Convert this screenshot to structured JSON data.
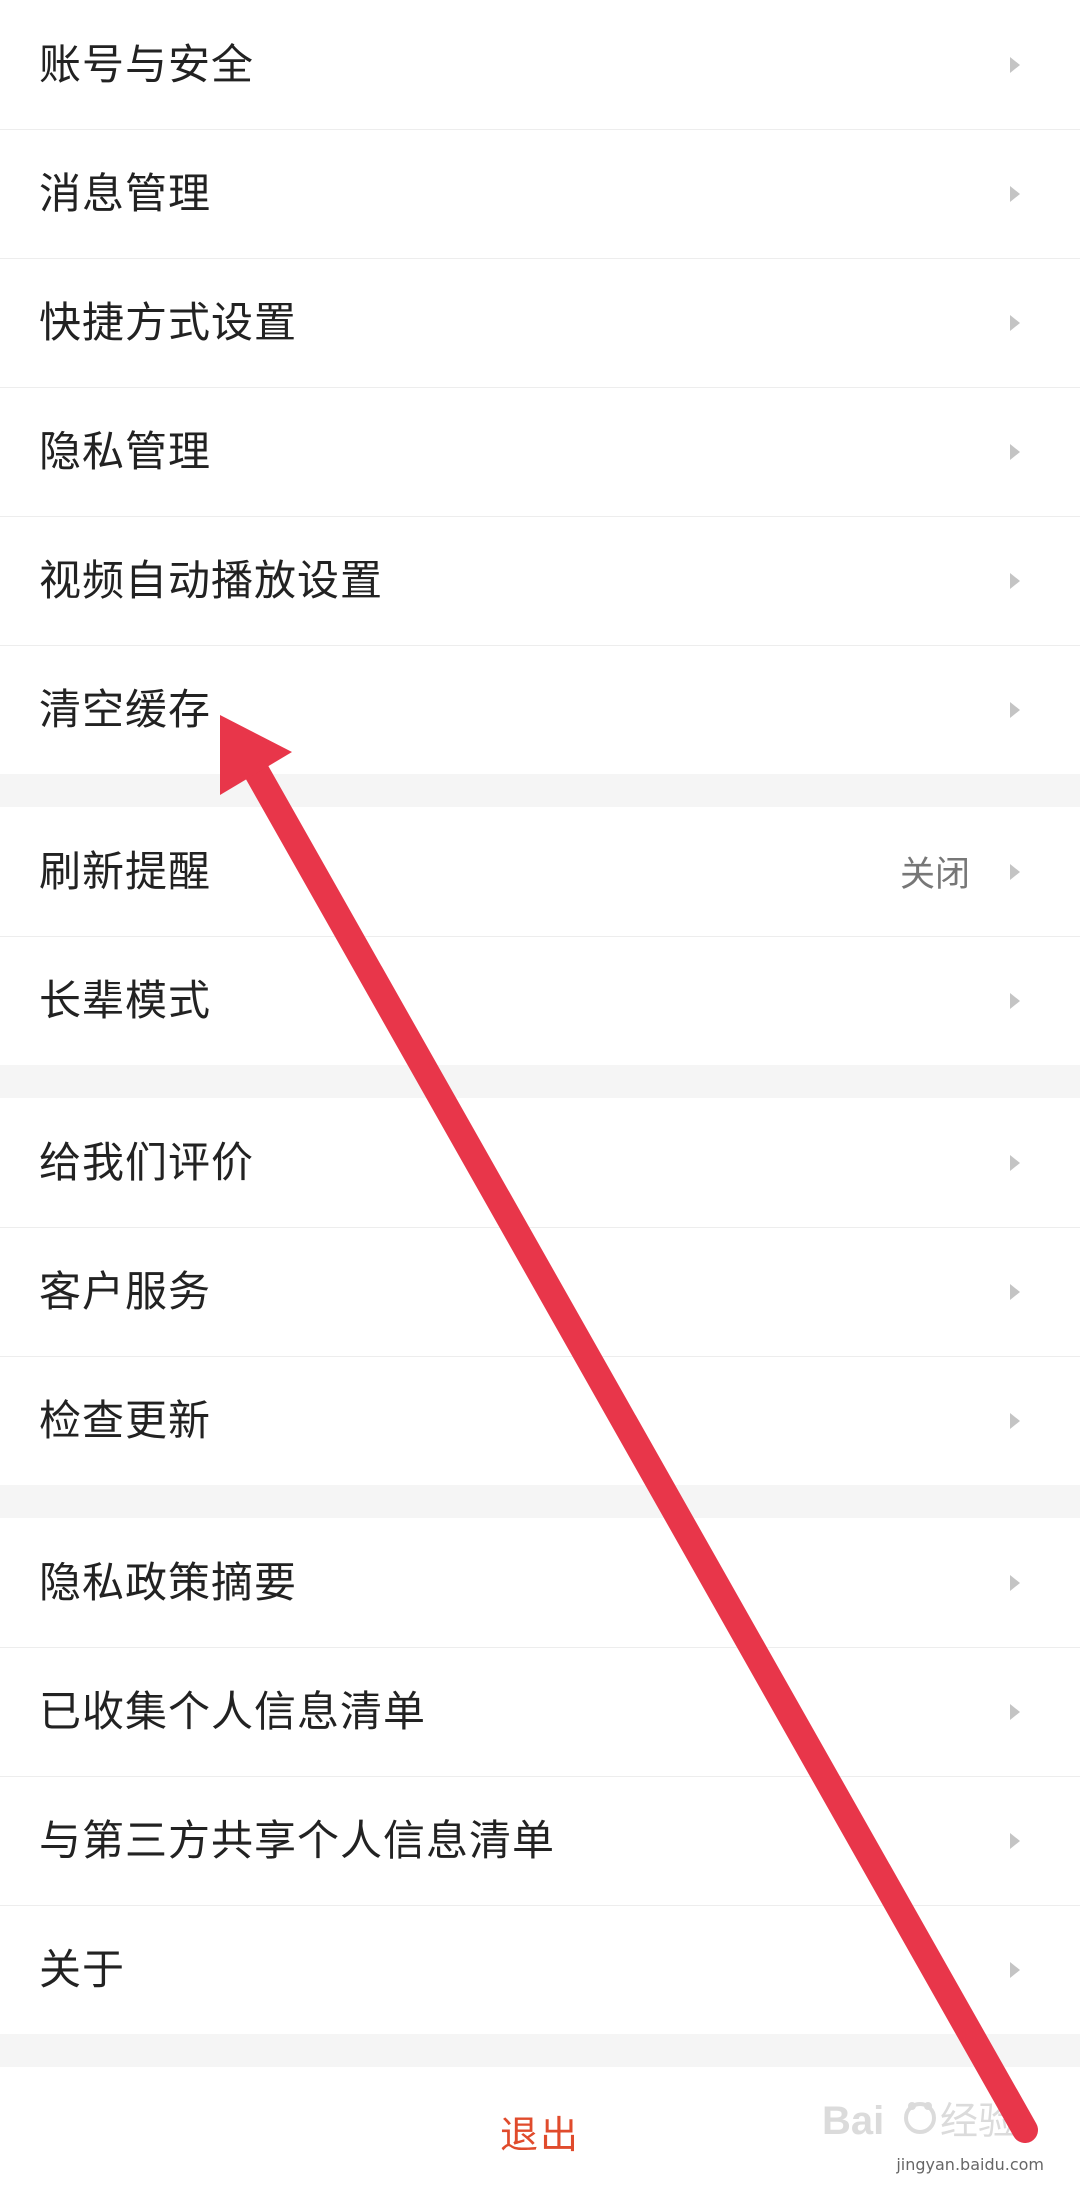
{
  "groups": [
    {
      "items": [
        {
          "label": "账号与安全"
        },
        {
          "label": "消息管理"
        },
        {
          "label": "快捷方式设置"
        },
        {
          "label": "隐私管理"
        },
        {
          "label": "视频自动播放设置"
        },
        {
          "label": "清空缓存"
        }
      ]
    },
    {
      "items": [
        {
          "label": "刷新提醒",
          "value": "关闭"
        },
        {
          "label": "长辈模式"
        }
      ]
    },
    {
      "items": [
        {
          "label": "给我们评价"
        },
        {
          "label": "客户服务"
        },
        {
          "label": "检查更新"
        }
      ]
    },
    {
      "items": [
        {
          "label": "隐私政策摘要"
        },
        {
          "label": "已收集个人信息清单"
        },
        {
          "label": "与第三方共享个人信息清单"
        },
        {
          "label": "关于"
        }
      ]
    }
  ],
  "logout_label": "退出",
  "watermark": {
    "brand": "Baidu经验",
    "url": "jingyan.baidu.com"
  },
  "colors": {
    "accent_logout": "#e04b2c",
    "annotation_arrow": "#e8364a",
    "background": "#f5f5f5",
    "row_background": "#ffffff"
  },
  "icons": {
    "row_chevron": "chevron-right-icon"
  }
}
